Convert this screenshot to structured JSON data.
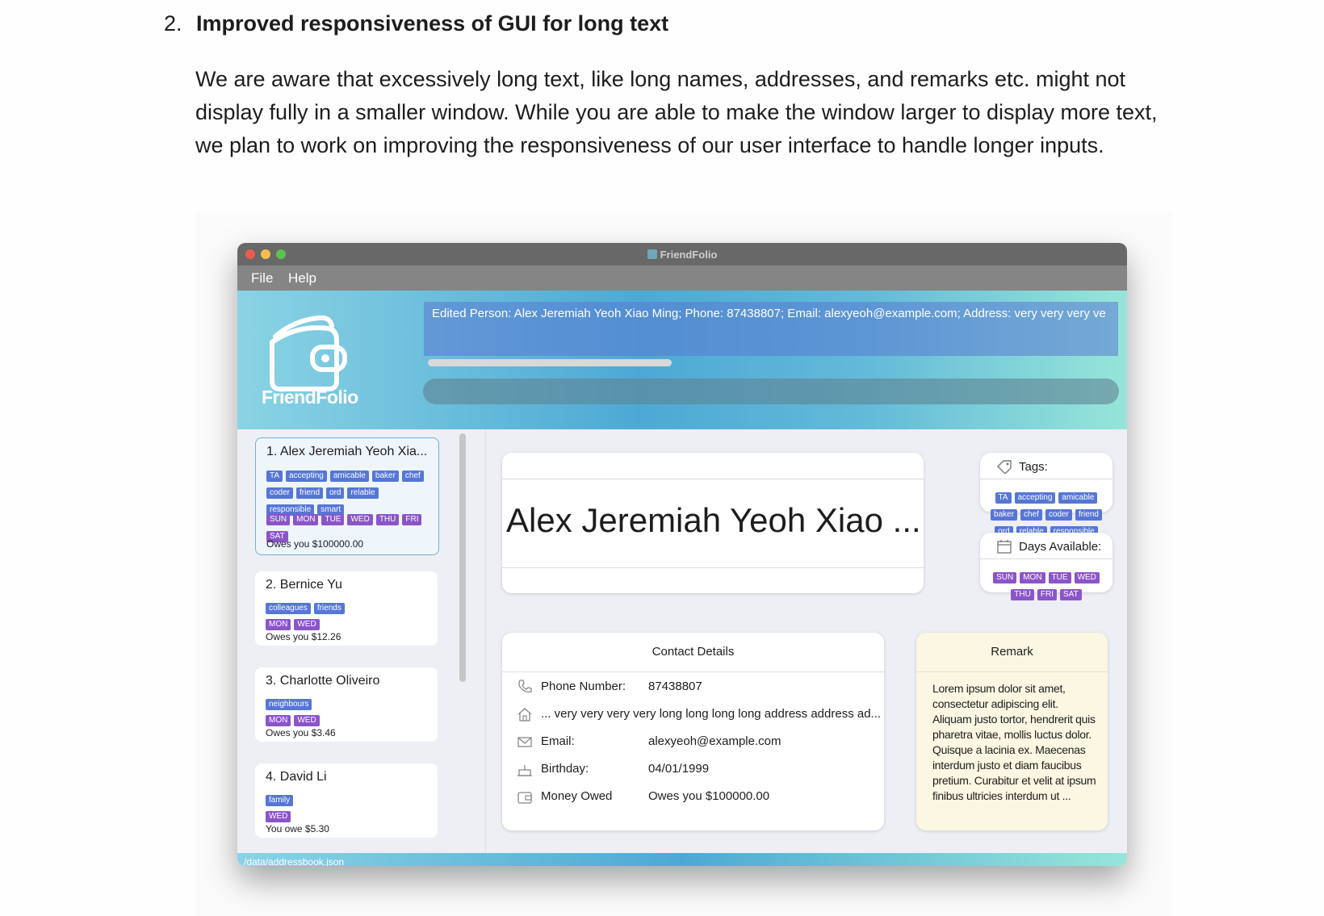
{
  "doc": {
    "number": "2.",
    "heading": "Improved responsiveness of GUI for long text",
    "paragraph": "We are aware that excessively long text, like long names, addresses, and remarks etc. might not display fully in a smaller window. While you are able to make the window larger to display more text, we plan to work on improving the responsiveness of our user interface to handle longer inputs."
  },
  "window": {
    "title": "FriendFolio"
  },
  "menu": {
    "file": "File",
    "help": "Help"
  },
  "banner": {
    "logo_text": "FriendFolio",
    "result": "Edited Person: Alex Jeremiah Yeoh Xiao Ming; Phone: 87438807; Email: alexyeoh@example.com; Address: very very very ve",
    "command_value": ""
  },
  "persons": [
    {
      "name": "1.  Alex Jeremiah Yeoh Xia...",
      "tags": [
        "TA",
        "accepting",
        "amicable",
        "baker",
        "chef",
        "coder",
        "friend",
        "ord",
        "relable",
        "responsible",
        "smart"
      ],
      "days": [
        "SUN",
        "MON",
        "TUE",
        "WED",
        "THU",
        "FRI",
        "SAT"
      ],
      "owes": "Owes you $100000.00",
      "selected": true
    },
    {
      "name": "2.  Bernice  Yu",
      "tags": [
        "colleagues",
        "friends"
      ],
      "days": [
        "MON",
        "WED"
      ],
      "owes": "Owes you $12.26",
      "selected": false
    },
    {
      "name": "3.  Charlotte Oliveiro",
      "tags": [
        "neighbours"
      ],
      "days": [
        "MON",
        "WED"
      ],
      "owes": "Owes you $3.46",
      "selected": false
    },
    {
      "name": "4.  David Li",
      "tags": [
        "family"
      ],
      "days": [
        "WED"
      ],
      "owes": "You owe $5.30",
      "selected": false
    }
  ],
  "detail": {
    "name": "Alex Jeremiah Yeoh Xiao ...",
    "tags_label": "Tags:",
    "tags": [
      "TA",
      "accepting",
      "amicable",
      "baker",
      "chef",
      "coder",
      "friend",
      "ord",
      "relable",
      "responsible"
    ],
    "days_label": "Days Available:",
    "days": [
      "SUN",
      "MON",
      "TUE",
      "WED",
      "THU",
      "FRI",
      "SAT"
    ],
    "contact_title": "Contact Details",
    "phone_label": "Phone Number:",
    "phone": "87438807",
    "address": "...   very very very very long long long long address address ad...",
    "email_label": "Email:",
    "email": "alexyeoh@example.com",
    "birthday_label": "Birthday:",
    "birthday": "04/01/1999",
    "money_label": "Money Owed",
    "money": "Owes you $100000.00",
    "remark_title": "Remark",
    "remark": "Lorem ipsum dolor sit amet, consectetur adipiscing elit. Aliquam justo tortor, hendrerit quis pharetra vitae, mollis luctus dolor. Quisque a lacinia ex. Maecenas interdum justo et diam faucibus pretium. Curabitur et velit at ipsum finibus ultricies interdum ut ..."
  },
  "status": {
    "path": "/data/addressbook.json"
  },
  "colors": {
    "tag": "#5676d6",
    "day": "#8b55c9",
    "banner_start": "#8ad3e4",
    "banner_end": "#97e5d9"
  }
}
